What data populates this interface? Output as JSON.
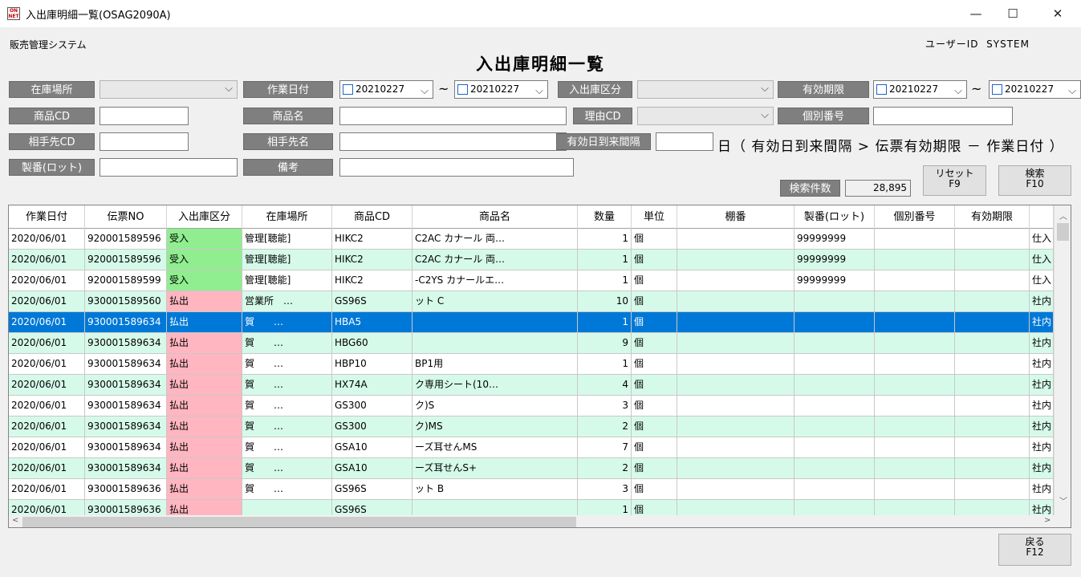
{
  "window": {
    "title": "入出庫明細一覧(OSAG2090A)",
    "icon_text": "ON NET",
    "min": "—",
    "max": "☐",
    "close": "✕"
  },
  "header": {
    "system_name": "販売管理システム",
    "user_label": "ユーザーID",
    "user_id": "SYSTEM",
    "page_title": "入出庫明細一覧"
  },
  "filters": {
    "warehouse_label": "在庫場所",
    "work_date_label": "作業日付",
    "work_date_from": "20210227",
    "work_date_to": "20210227",
    "io_type_label": "入出庫区分",
    "expiry_label": "有効期限",
    "expiry_from": "20210227",
    "expiry_to": "20210227",
    "tilde": "~",
    "product_cd_label": "商品CD",
    "product_name_label": "商品名",
    "reason_cd_label": "理由CD",
    "serial_label": "個別番号",
    "partner_cd_label": "相手先CD",
    "partner_name_label": "相手先名",
    "interval_label": "有効日到来間隔",
    "interval_unit": "日",
    "interval_note": "（ 有効日到来間隔 > 伝票有効期限 － 作業日付 ）",
    "lot_label": "製番(ロット)",
    "remarks_label": "備考"
  },
  "actions": {
    "count_label": "検索件数",
    "count_value": "28,895",
    "reset_label": "リセット",
    "reset_key": "F9",
    "search_label": "検索",
    "search_key": "F10",
    "back_label": "戻る",
    "back_key": "F12"
  },
  "colors": {
    "receive": "#90ee90",
    "issue": "#ffb6c1",
    "alt_row": "#d6faea",
    "selected": "#0078d7"
  },
  "table": {
    "columns": [
      "作業日付",
      "伝票NO",
      "入出庫区分",
      "在庫場所",
      "商品CD",
      "商品名",
      "数量",
      "単位",
      "棚番",
      "製番(ロット)",
      "個別番号",
      "有効期限",
      ""
    ],
    "rows": [
      {
        "date": "2020/06/01",
        "no": "920001589596",
        "type": "受入",
        "kind": "in",
        "wh": "管理[聴能]",
        "cd": "HIKC2",
        "name": "C2AC カナール 両…",
        "qty": "1",
        "unit": "個",
        "shelf": "",
        "lot": "99999999",
        "serial": "",
        "expiry": "",
        "note": "仕入",
        "alt": false
      },
      {
        "date": "2020/06/01",
        "no": "920001589596",
        "type": "受入",
        "kind": "in",
        "wh": "管理[聴能]",
        "cd": "HIKC2",
        "name": "C2AC カナール 両…",
        "qty": "1",
        "unit": "個",
        "shelf": "",
        "lot": "99999999",
        "serial": "",
        "expiry": "",
        "note": "仕入",
        "alt": true
      },
      {
        "date": "2020/06/01",
        "no": "920001589599",
        "type": "受入",
        "kind": "in",
        "wh": "管理[聴能]",
        "cd": "HIKC2",
        "name": "-C2YS カナールエ…",
        "qty": "1",
        "unit": "個",
        "shelf": "",
        "lot": "99999999",
        "serial": "",
        "expiry": "",
        "note": "仕入",
        "alt": false
      },
      {
        "date": "2020/06/01",
        "no": "930001589560",
        "type": "払出",
        "kind": "out",
        "wh": "営業所　…",
        "cd": "GS96S",
        "name": "ット C",
        "qty": "10",
        "unit": "個",
        "shelf": "",
        "lot": "",
        "serial": "",
        "expiry": "",
        "note": "社内",
        "alt": true
      },
      {
        "date": "2020/06/01",
        "no": "930001589634",
        "type": "払出",
        "kind": "out",
        "wh": "賀　　…",
        "cd": "HBA5",
        "name": "",
        "qty": "1",
        "unit": "個",
        "shelf": "",
        "lot": "",
        "serial": "",
        "expiry": "",
        "note": "社内",
        "alt": false,
        "selected": true
      },
      {
        "date": "2020/06/01",
        "no": "930001589634",
        "type": "払出",
        "kind": "out",
        "wh": "賀　　…",
        "cd": "HBG60",
        "name": "",
        "qty": "9",
        "unit": "個",
        "shelf": "",
        "lot": "",
        "serial": "",
        "expiry": "",
        "note": "社内",
        "alt": true
      },
      {
        "date": "2020/06/01",
        "no": "930001589634",
        "type": "払出",
        "kind": "out",
        "wh": "賀　　…",
        "cd": "HBP10",
        "name": "BP1用",
        "qty": "1",
        "unit": "個",
        "shelf": "",
        "lot": "",
        "serial": "",
        "expiry": "",
        "note": "社内",
        "alt": false
      },
      {
        "date": "2020/06/01",
        "no": "930001589634",
        "type": "払出",
        "kind": "out",
        "wh": "賀　　…",
        "cd": "HX74A",
        "name": "ク専用シート(10…",
        "qty": "4",
        "unit": "個",
        "shelf": "",
        "lot": "",
        "serial": "",
        "expiry": "",
        "note": "社内",
        "alt": true
      },
      {
        "date": "2020/06/01",
        "no": "930001589634",
        "type": "払出",
        "kind": "out",
        "wh": "賀　　…",
        "cd": "GS300",
        "name": "ク)S",
        "qty": "3",
        "unit": "個",
        "shelf": "",
        "lot": "",
        "serial": "",
        "expiry": "",
        "note": "社内",
        "alt": false
      },
      {
        "date": "2020/06/01",
        "no": "930001589634",
        "type": "払出",
        "kind": "out",
        "wh": "賀　　…",
        "cd": "GS300",
        "name": "ク)MS",
        "qty": "2",
        "unit": "個",
        "shelf": "",
        "lot": "",
        "serial": "",
        "expiry": "",
        "note": "社内",
        "alt": true
      },
      {
        "date": "2020/06/01",
        "no": "930001589634",
        "type": "払出",
        "kind": "out",
        "wh": "賀　　…",
        "cd": "GSA10",
        "name": "ーズ耳せんMS",
        "qty": "7",
        "unit": "個",
        "shelf": "",
        "lot": "",
        "serial": "",
        "expiry": "",
        "note": "社内",
        "alt": false
      },
      {
        "date": "2020/06/01",
        "no": "930001589634",
        "type": "払出",
        "kind": "out",
        "wh": "賀　　…",
        "cd": "GSA10",
        "name": "ーズ耳せんS+",
        "qty": "2",
        "unit": "個",
        "shelf": "",
        "lot": "",
        "serial": "",
        "expiry": "",
        "note": "社内",
        "alt": true
      },
      {
        "date": "2020/06/01",
        "no": "930001589636",
        "type": "払出",
        "kind": "out",
        "wh": "賀　　…",
        "cd": "GS96S",
        "name": "ット B",
        "qty": "3",
        "unit": "個",
        "shelf": "",
        "lot": "",
        "serial": "",
        "expiry": "",
        "note": "社内",
        "alt": false
      },
      {
        "date": "2020/06/01",
        "no": "930001589636",
        "type": "払出",
        "kind": "out",
        "wh": "",
        "cd": "GS96S",
        "name": "",
        "qty": "1",
        "unit": "個",
        "shelf": "",
        "lot": "",
        "serial": "",
        "expiry": "",
        "note": "社内",
        "alt": true
      }
    ]
  }
}
